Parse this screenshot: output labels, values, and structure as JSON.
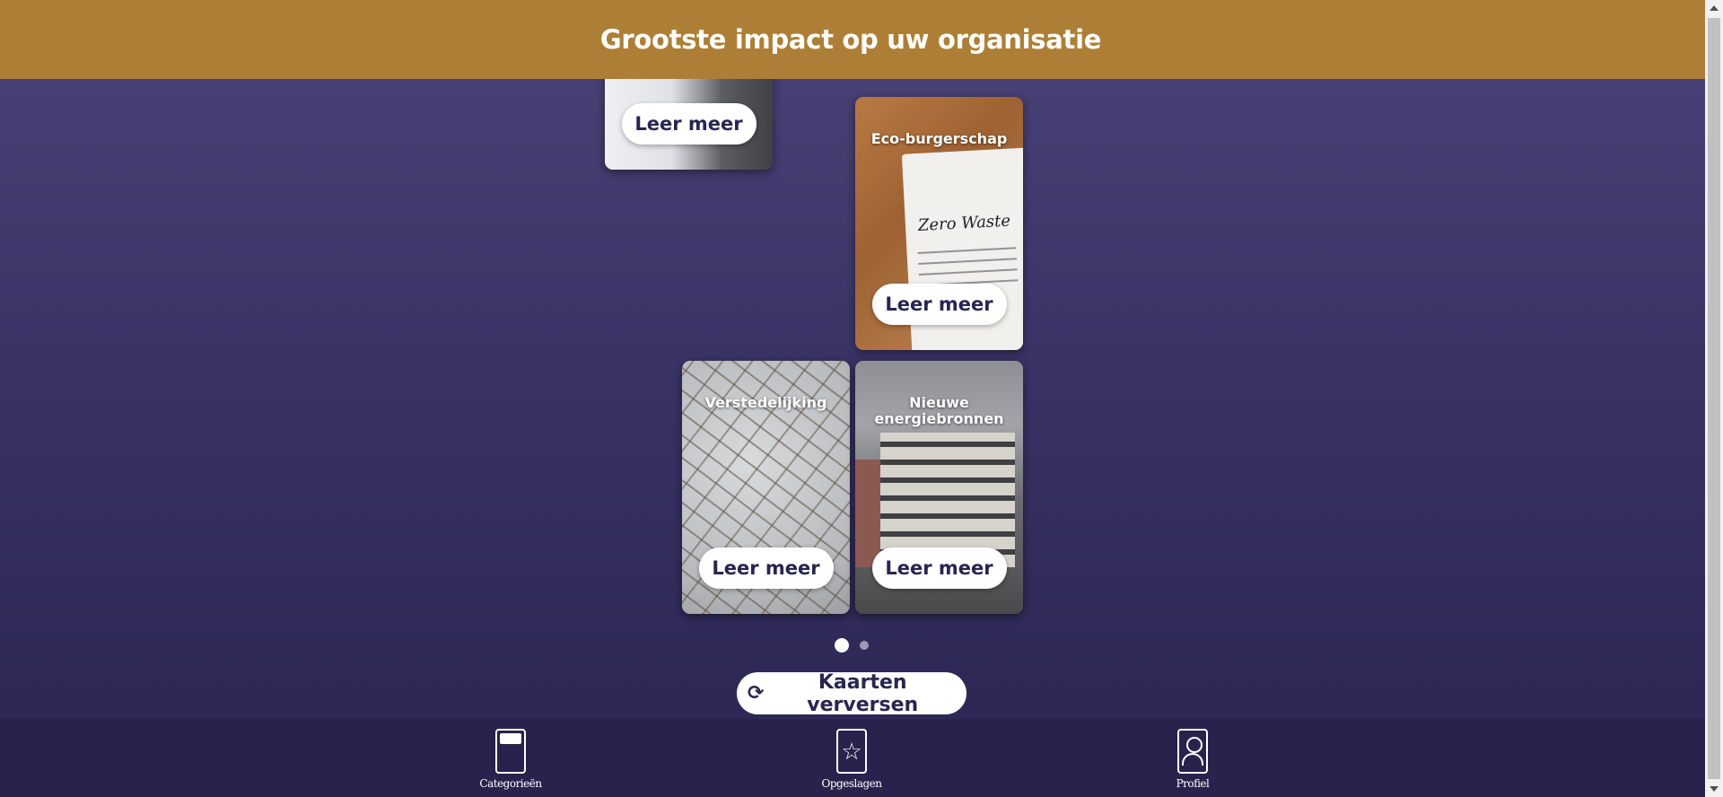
{
  "header": {
    "title": "Grootste impact op uw organisatie"
  },
  "cards": [
    {
      "title": "",
      "button": "Leer meer"
    },
    {
      "title": "Eco-burgerschap",
      "button": "Leer meer",
      "image_text": "Zero Waste"
    },
    {
      "title": "Verstedelijking",
      "button": "Leer meer"
    },
    {
      "title": "Nieuwe energiebronnen",
      "button": "Leer meer"
    }
  ],
  "pagination": {
    "current": 1,
    "total": 2
  },
  "refresh_button": {
    "icon": "refresh-icon",
    "label": "Kaarten verversen"
  },
  "bottom_nav": [
    {
      "icon": "categories-icon",
      "label": "Categorieën"
    },
    {
      "icon": "star-icon",
      "label": "Opgeslagen"
    },
    {
      "icon": "profile-icon",
      "label": "Profiel"
    }
  ],
  "colors": {
    "header": "#ad7f36",
    "background": "#3a3366",
    "bottom_nav": "#28224c",
    "button_text": "#2a2550"
  }
}
